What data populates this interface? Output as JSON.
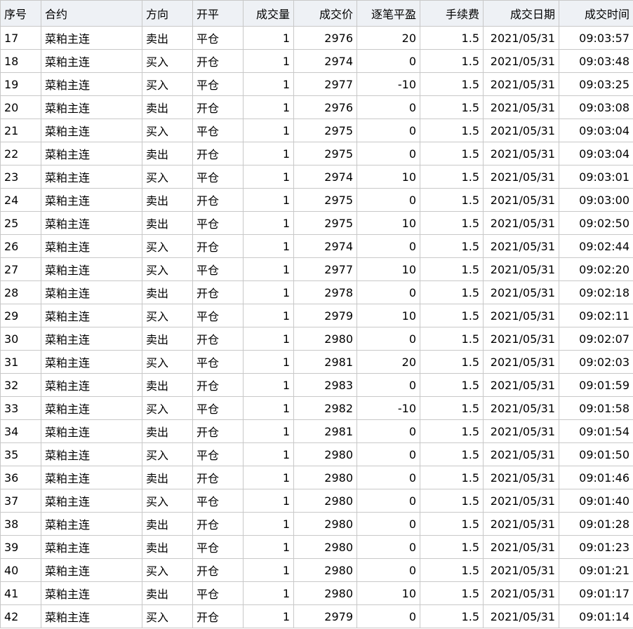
{
  "columns": [
    "序号",
    "合约",
    "方向",
    "开平",
    "成交量",
    "成交价",
    "逐笔平盈",
    "手续费",
    "成交日期",
    "成交时间"
  ],
  "colors": {
    "sell": "#19a019",
    "buy": "#e02020",
    "profit": "#e02020",
    "loss": "#19a019"
  },
  "rows": [
    {
      "seq": "17",
      "contract": "菜粕主连",
      "direction": "卖出",
      "openclose": "平仓",
      "volume": "1",
      "price": "2976",
      "pnl": "20",
      "fee": "1.5",
      "date": "2021/05/31",
      "time": "09:03:57"
    },
    {
      "seq": "18",
      "contract": "菜粕主连",
      "direction": "买入",
      "openclose": "开仓",
      "volume": "1",
      "price": "2974",
      "pnl": "0",
      "fee": "1.5",
      "date": "2021/05/31",
      "time": "09:03:48"
    },
    {
      "seq": "19",
      "contract": "菜粕主连",
      "direction": "买入",
      "openclose": "平仓",
      "volume": "1",
      "price": "2977",
      "pnl": "-10",
      "fee": "1.5",
      "date": "2021/05/31",
      "time": "09:03:25"
    },
    {
      "seq": "20",
      "contract": "菜粕主连",
      "direction": "卖出",
      "openclose": "开仓",
      "volume": "1",
      "price": "2976",
      "pnl": "0",
      "fee": "1.5",
      "date": "2021/05/31",
      "time": "09:03:08"
    },
    {
      "seq": "21",
      "contract": "菜粕主连",
      "direction": "买入",
      "openclose": "平仓",
      "volume": "1",
      "price": "2975",
      "pnl": "0",
      "fee": "1.5",
      "date": "2021/05/31",
      "time": "09:03:04"
    },
    {
      "seq": "22",
      "contract": "菜粕主连",
      "direction": "卖出",
      "openclose": "开仓",
      "volume": "1",
      "price": "2975",
      "pnl": "0",
      "fee": "1.5",
      "date": "2021/05/31",
      "time": "09:03:04"
    },
    {
      "seq": "23",
      "contract": "菜粕主连",
      "direction": "买入",
      "openclose": "平仓",
      "volume": "1",
      "price": "2974",
      "pnl": "10",
      "fee": "1.5",
      "date": "2021/05/31",
      "time": "09:03:01"
    },
    {
      "seq": "24",
      "contract": "菜粕主连",
      "direction": "卖出",
      "openclose": "开仓",
      "volume": "1",
      "price": "2975",
      "pnl": "0",
      "fee": "1.5",
      "date": "2021/05/31",
      "time": "09:03:00"
    },
    {
      "seq": "25",
      "contract": "菜粕主连",
      "direction": "卖出",
      "openclose": "平仓",
      "volume": "1",
      "price": "2975",
      "pnl": "10",
      "fee": "1.5",
      "date": "2021/05/31",
      "time": "09:02:50"
    },
    {
      "seq": "26",
      "contract": "菜粕主连",
      "direction": "买入",
      "openclose": "开仓",
      "volume": "1",
      "price": "2974",
      "pnl": "0",
      "fee": "1.5",
      "date": "2021/05/31",
      "time": "09:02:44"
    },
    {
      "seq": "27",
      "contract": "菜粕主连",
      "direction": "买入",
      "openclose": "平仓",
      "volume": "1",
      "price": "2977",
      "pnl": "10",
      "fee": "1.5",
      "date": "2021/05/31",
      "time": "09:02:20"
    },
    {
      "seq": "28",
      "contract": "菜粕主连",
      "direction": "卖出",
      "openclose": "开仓",
      "volume": "1",
      "price": "2978",
      "pnl": "0",
      "fee": "1.5",
      "date": "2021/05/31",
      "time": "09:02:18"
    },
    {
      "seq": "29",
      "contract": "菜粕主连",
      "direction": "买入",
      "openclose": "平仓",
      "volume": "1",
      "price": "2979",
      "pnl": "10",
      "fee": "1.5",
      "date": "2021/05/31",
      "time": "09:02:11"
    },
    {
      "seq": "30",
      "contract": "菜粕主连",
      "direction": "卖出",
      "openclose": "开仓",
      "volume": "1",
      "price": "2980",
      "pnl": "0",
      "fee": "1.5",
      "date": "2021/05/31",
      "time": "09:02:07"
    },
    {
      "seq": "31",
      "contract": "菜粕主连",
      "direction": "买入",
      "openclose": "平仓",
      "volume": "1",
      "price": "2981",
      "pnl": "20",
      "fee": "1.5",
      "date": "2021/05/31",
      "time": "09:02:03"
    },
    {
      "seq": "32",
      "contract": "菜粕主连",
      "direction": "卖出",
      "openclose": "开仓",
      "volume": "1",
      "price": "2983",
      "pnl": "0",
      "fee": "1.5",
      "date": "2021/05/31",
      "time": "09:01:59"
    },
    {
      "seq": "33",
      "contract": "菜粕主连",
      "direction": "买入",
      "openclose": "平仓",
      "volume": "1",
      "price": "2982",
      "pnl": "-10",
      "fee": "1.5",
      "date": "2021/05/31",
      "time": "09:01:58"
    },
    {
      "seq": "34",
      "contract": "菜粕主连",
      "direction": "卖出",
      "openclose": "开仓",
      "volume": "1",
      "price": "2981",
      "pnl": "0",
      "fee": "1.5",
      "date": "2021/05/31",
      "time": "09:01:54"
    },
    {
      "seq": "35",
      "contract": "菜粕主连",
      "direction": "买入",
      "openclose": "平仓",
      "volume": "1",
      "price": "2980",
      "pnl": "0",
      "fee": "1.5",
      "date": "2021/05/31",
      "time": "09:01:50"
    },
    {
      "seq": "36",
      "contract": "菜粕主连",
      "direction": "卖出",
      "openclose": "开仓",
      "volume": "1",
      "price": "2980",
      "pnl": "0",
      "fee": "1.5",
      "date": "2021/05/31",
      "time": "09:01:46"
    },
    {
      "seq": "37",
      "contract": "菜粕主连",
      "direction": "买入",
      "openclose": "平仓",
      "volume": "1",
      "price": "2980",
      "pnl": "0",
      "fee": "1.5",
      "date": "2021/05/31",
      "time": "09:01:40"
    },
    {
      "seq": "38",
      "contract": "菜粕主连",
      "direction": "卖出",
      "openclose": "开仓",
      "volume": "1",
      "price": "2980",
      "pnl": "0",
      "fee": "1.5",
      "date": "2021/05/31",
      "time": "09:01:28"
    },
    {
      "seq": "39",
      "contract": "菜粕主连",
      "direction": "卖出",
      "openclose": "平仓",
      "volume": "1",
      "price": "2980",
      "pnl": "0",
      "fee": "1.5",
      "date": "2021/05/31",
      "time": "09:01:23"
    },
    {
      "seq": "40",
      "contract": "菜粕主连",
      "direction": "买入",
      "openclose": "开仓",
      "volume": "1",
      "price": "2980",
      "pnl": "0",
      "fee": "1.5",
      "date": "2021/05/31",
      "time": "09:01:21"
    },
    {
      "seq": "41",
      "contract": "菜粕主连",
      "direction": "卖出",
      "openclose": "平仓",
      "volume": "1",
      "price": "2980",
      "pnl": "10",
      "fee": "1.5",
      "date": "2021/05/31",
      "time": "09:01:17"
    },
    {
      "seq": "42",
      "contract": "菜粕主连",
      "direction": "买入",
      "openclose": "开仓",
      "volume": "1",
      "price": "2979",
      "pnl": "0",
      "fee": "1.5",
      "date": "2021/05/31",
      "time": "09:01:14"
    }
  ]
}
